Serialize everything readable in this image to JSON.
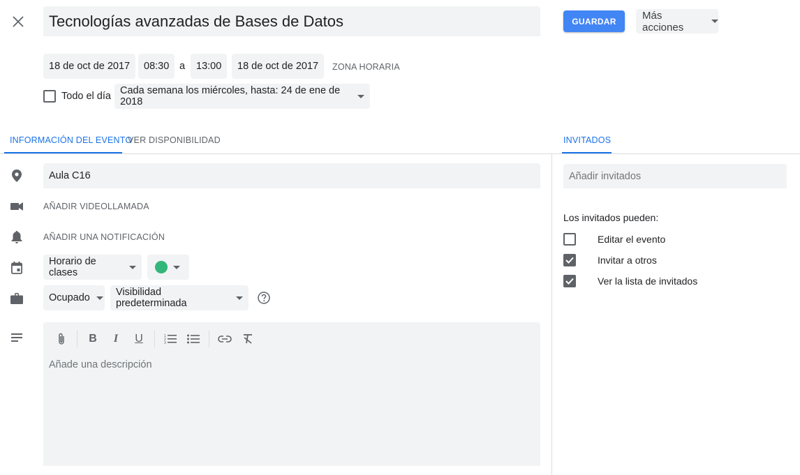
{
  "header": {
    "title": "Tecnologías avanzadas de Bases de Datos",
    "save_label": "GUARDAR",
    "more_actions_label": "Más acciones"
  },
  "datetime": {
    "start_date": "18 de oct de 2017",
    "start_time": "08:30",
    "separator": "a",
    "end_time": "13:00",
    "end_date": "18 de oct de 2017",
    "timezone_label": "ZONA HORARIA",
    "all_day_label": "Todo el día",
    "all_day_checked": false,
    "recurrence": "Cada semana los miércoles, hasta: 24 de ene de 2018"
  },
  "tabs": {
    "event_info": "INFORMACIÓN DEL EVENTO",
    "availability": "VER DISPONIBILIDAD",
    "guests": "INVITADOS"
  },
  "details": {
    "location": "Aula C16",
    "add_video_call": "AÑADIR VIDEOLLAMADA",
    "add_notification": "AÑADIR UNA NOTIFICACIÓN",
    "calendar": "Horario de clases",
    "event_color": "#33b679",
    "availability_status": "Ocupado",
    "visibility": "Visibilidad predeterminada",
    "description_placeholder": "Añade una descripción"
  },
  "guests": {
    "add_placeholder": "Añadir invitados",
    "permissions_heading": "Los invitados pueden:",
    "permissions": [
      {
        "label": "Editar el evento",
        "checked": false
      },
      {
        "label": "Invitar a otros",
        "checked": true
      },
      {
        "label": "Ver la lista de invitados",
        "checked": true
      }
    ]
  },
  "colors": {
    "accent": "#1a73e8",
    "save_button": "#4285f4",
    "field_background": "#f1f3f4"
  }
}
